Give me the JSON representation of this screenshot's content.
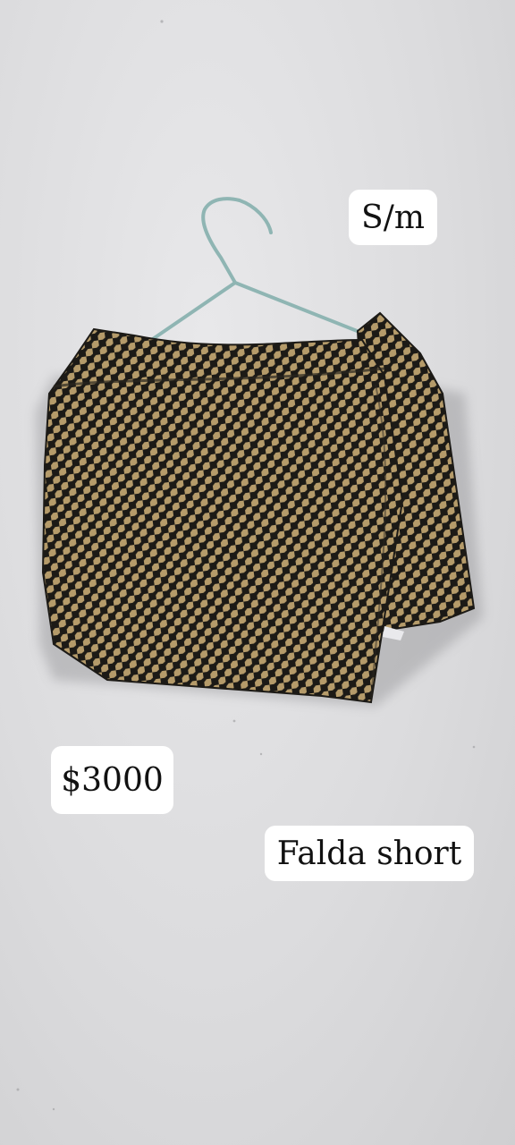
{
  "labels": {
    "size": "S/m",
    "price": "$3000",
    "item_name": "Falda short"
  },
  "colors": {
    "wall": "#dcdcde",
    "fabric_light": "#b59b6a",
    "fabric_dark": "#1c1a16",
    "hanger": "#8fb5b3",
    "tag_background": "#ffffff"
  },
  "icons": {
    "hanger": "hanger-icon"
  }
}
